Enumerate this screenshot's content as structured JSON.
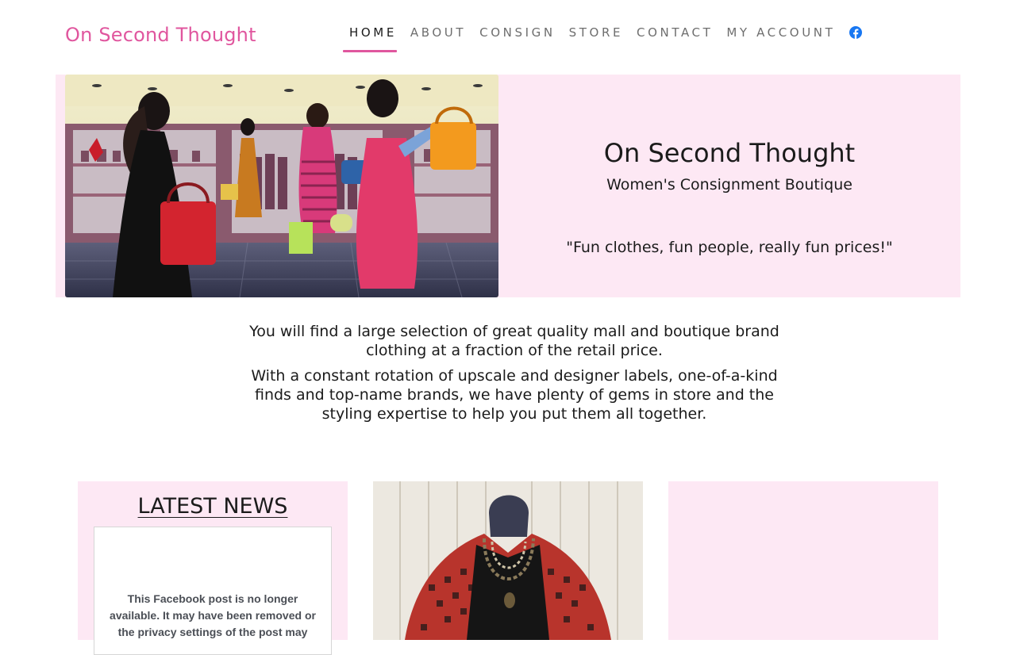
{
  "header": {
    "logo": "On Second Thought",
    "nav": [
      {
        "label": "HOME",
        "active": true
      },
      {
        "label": "ABOUT",
        "active": false
      },
      {
        "label": "CONSIGN",
        "active": false
      },
      {
        "label": "STORE",
        "active": false
      },
      {
        "label": "CONTACT",
        "active": false
      },
      {
        "label": "MY ACCOUNT",
        "active": false
      }
    ],
    "social_icon": "facebook-icon"
  },
  "hero": {
    "image": "illustration-women-shopping",
    "title": "On Second Thought",
    "subtitle": "Women's Consignment Boutique",
    "tagline": "\"Fun clothes, fun people, really fun prices!\""
  },
  "intro": {
    "paragraph1": "You will find a large selection of great quality mall and boutique brand clothing at a fraction of the retail price.",
    "paragraph2": "With a constant rotation of upscale and designer labels, one-of-a-kind finds and top-name brands, we have plenty of gems in store and the styling expertise to help you put them all together."
  },
  "cards": {
    "news_title": "LATEST NEWS",
    "facebook_embed_message": "This Facebook post is no longer available. It may have been removed or the privacy settings of the post may",
    "photo": "mannequin-houndstooth-cardigan"
  },
  "colors": {
    "accent": "#e0569e",
    "panel_pink": "#fde8f4",
    "text": "#1b1b1b",
    "nav_text": "#6e6e6e",
    "facebook_blue": "#1877f2"
  }
}
